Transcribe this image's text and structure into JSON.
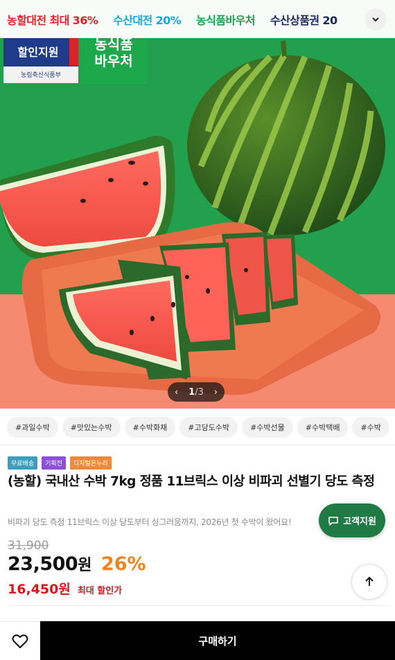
{
  "top_tabs": [
    {
      "label": "농할대전 최대 36%",
      "color": "#e8202a"
    },
    {
      "label": "수산대전 20%",
      "color": "#17a7d9"
    },
    {
      "label": "농식품바우처",
      "color": "#1e9e50"
    },
    {
      "label": "수산상품권 20",
      "color": "#1b2a57"
    }
  ],
  "top_more_icon": "chevron-down-icon",
  "hero": {
    "logo_text": "할인지원",
    "logo_caption": "농림축산식품부",
    "voucher_text_1": "농식품",
    "voucher_text_2": "바우처",
    "pager_current": "1",
    "pager_sep": "/",
    "pager_total": "3"
  },
  "tags": [
    "#과일수박",
    "#맛있는수박",
    "#수박화채",
    "#고당도수박",
    "#수박선물",
    "#수박택배",
    "#수박"
  ],
  "badges": [
    {
      "label": "무료배송",
      "color": "#3e9dbd"
    },
    {
      "label": "기획전",
      "color": "#8d4ed8"
    },
    {
      "label": "디지털온누리",
      "color": "#ee8a3a"
    }
  ],
  "product": {
    "title": "(농할) 국내산 수박 7kg 정품 11브릭스 이상 비파괴 선별기 당도 측정",
    "subtitle": "비파괴 당도 측정 11브릭스 이상 당도부터 싱그러움까지, 2026년 첫 수박이 왔어요!",
    "original_price": "31,900",
    "price": "23,500",
    "price_unit": "원",
    "discount_rate": "26%",
    "max_discount_price": "16,450원",
    "max_discount_label": "최대 할인가"
  },
  "support_button": {
    "label": "고객지원",
    "icon": "chat-icon"
  },
  "scroll_top_icon": "arrow-up-icon",
  "bottom_bar": {
    "wish_icon": "heart-icon",
    "buy_label": "구매하기"
  }
}
